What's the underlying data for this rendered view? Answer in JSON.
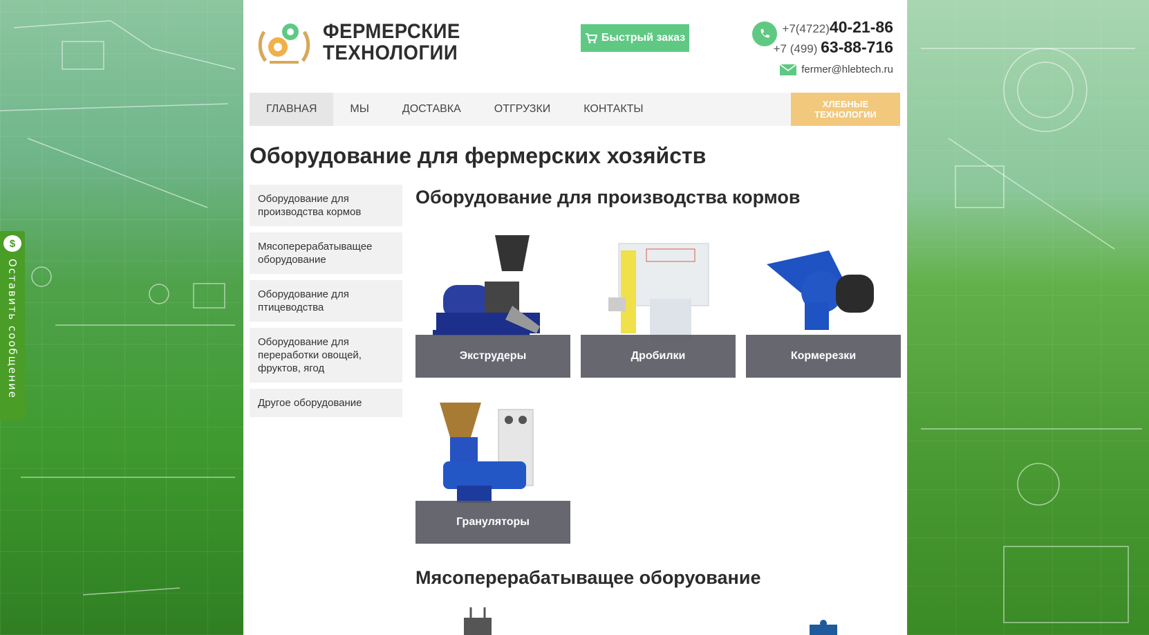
{
  "header": {
    "brand_line1": "ФЕРМЕРСКИЕ",
    "brand_line2": "ТЕХНОЛОГИИ",
    "quick_order": "Быстрый заказ",
    "phone1_prefix": "+7(4722)",
    "phone1_number": "40-21-86",
    "phone2_prefix": "+7 (499)",
    "phone2_number": "63-88-716",
    "email": "fermer@hlebtech.ru"
  },
  "nav": {
    "items": [
      "ГЛАВНАЯ",
      "МЫ",
      "ДОСТАВКА",
      "ОТГРУЗКИ",
      "КОНТАКТЫ"
    ],
    "cta": "ХЛЕБНЫЕ ТЕХНОЛОГИИ"
  },
  "side_tab": "Оставить сообщение",
  "page_title": "Оборудование для фермерских хозяйств",
  "sidebar": [
    "Оборудование для производства кормов",
    "Мясоперерабатыващее оборудование",
    "Оборудование для птицеводства",
    "Оборудование для переработки овощей, фруктов, ягод",
    "Другое оборудование"
  ],
  "sections": [
    {
      "title": "Оборудование для производства кормов",
      "cards": [
        "Экструдеры",
        "Дробилки",
        "Кормерезки",
        "Грануляторы"
      ]
    },
    {
      "title": "Мясоперерабатыващее оборуование",
      "cards": []
    }
  ],
  "colors": {
    "accent_green": "#5fc984",
    "cta_orange": "#f2c87c",
    "side_tab_green": "#4a9d26"
  }
}
